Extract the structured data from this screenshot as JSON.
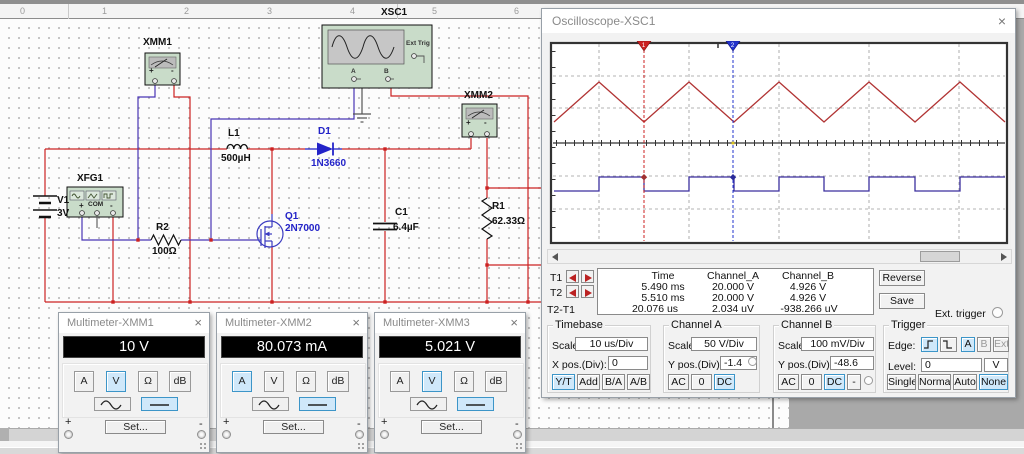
{
  "ui": {
    "close": "×"
  },
  "ruler": {
    "numbers": [
      "0",
      "1",
      "2",
      "3",
      "4",
      "5",
      "6"
    ]
  },
  "circuit": {
    "xmm1": {
      "label": "XMM1",
      "plus": "+",
      "minus": "-"
    },
    "xmm2": {
      "label": "XMM2",
      "plus": "+",
      "minus": "-"
    },
    "xfg1": {
      "label": "XFG1",
      "plus": "+",
      "com": "COM",
      "minus": "-"
    },
    "xsc1": {
      "label": "XSC1",
      "ext_trig": "Ext Trig",
      "a": "A",
      "b": "B"
    },
    "v1": {
      "ref": "V1",
      "value": "3V"
    },
    "r2": {
      "ref": "R2",
      "value": "100Ω"
    },
    "l1": {
      "ref": "L1",
      "value": "500µH"
    },
    "d1": {
      "ref": "D1",
      "value": "1N3660"
    },
    "q1": {
      "ref": "Q1",
      "value": "2N7000"
    },
    "c1": {
      "ref": "C1",
      "value": "6.4µF"
    },
    "r1": {
      "ref": "R1",
      "value": "62.33Ω"
    }
  },
  "oscilloscope": {
    "title": "Oscilloscope-XSC1",
    "cursors": {
      "c1": "1",
      "c2": "2"
    },
    "waveforms": {
      "channel_a": "triangle",
      "channel_b": "square"
    },
    "readout": {
      "headers": {
        "time": "Time",
        "a": "Channel_A",
        "b": "Channel_B"
      },
      "t1": {
        "label": "T1",
        "time": "5.490 ms",
        "a": "20.000 V",
        "b": "4.926 V"
      },
      "t2": {
        "label": "T2",
        "time": "5.510 ms",
        "a": "20.000 V",
        "b": "4.926 V"
      },
      "dt": {
        "label": "T2-T1",
        "time": "20.076 us",
        "a": "2.034 uV",
        "b": "-938.266 uV"
      }
    },
    "reverse": "Reverse",
    "save": "Save",
    "ext_trigger": "Ext. trigger",
    "timebase": {
      "title": "Timebase",
      "scale_label": "Scale:",
      "scale": "10 us/Div",
      "xpos_label": "X pos.(Div):",
      "xpos": "0",
      "yt": "Y/T",
      "add": "Add",
      "ba": "B/A",
      "ab": "A/B"
    },
    "channel_a": {
      "title": "Channel A",
      "scale_label": "Scale:",
      "scale": "50 V/Div",
      "ypos_label": "Y pos.(Div):",
      "ypos": "-1.4",
      "ac": "AC",
      "zero": "0",
      "dc": "DC"
    },
    "channel_b": {
      "title": "Channel B",
      "scale_label": "Scale:",
      "scale": "100 mV/Div",
      "ypos_label": "Y pos.(Div):",
      "ypos": "-48.6",
      "ac": "AC",
      "zero": "0",
      "dc": "DC",
      "minus": "-"
    },
    "trigger": {
      "title": "Trigger",
      "edge_label": "Edge:",
      "a": "A",
      "b": "B",
      "ext": "Ext",
      "level_label": "Level:",
      "level": "0",
      "unit": "V",
      "single": "Single",
      "normal": "Normal",
      "auto": "Auto",
      "none": "None"
    }
  },
  "multimeter_shared": {
    "modes": [
      "A",
      "V",
      "Ω",
      "dB"
    ],
    "set": "Set...",
    "plus": "+",
    "minus": "-"
  },
  "multimeters": [
    {
      "title": "Multimeter-XMM1",
      "reading": "10 V"
    },
    {
      "title": "Multimeter-XMM2",
      "reading": "80.073 mA"
    },
    {
      "title": "Multimeter-XMM3",
      "reading": "5.021 V"
    }
  ]
}
